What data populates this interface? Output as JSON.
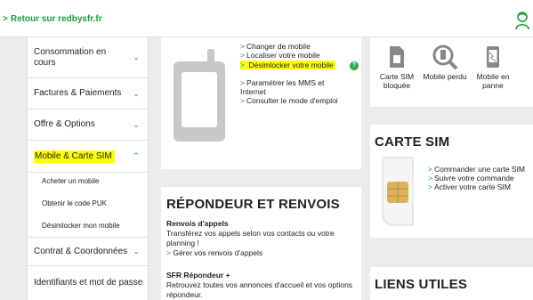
{
  "header": {
    "back_label": "Retour sur redbysfr.fr",
    "account_icon": "user-icon",
    "accent_color": "#1b9e3e"
  },
  "sidebar": {
    "items": [
      {
        "label": "Consommation en cours"
      },
      {
        "label": "Factures & Paiements"
      },
      {
        "label": "Offre & Options"
      },
      {
        "label": "Mobile & Carte SIM"
      },
      {
        "label": "Contrat & Coordonnées"
      },
      {
        "label": "Identifiants et mot de passe"
      }
    ],
    "sub_items": [
      {
        "label": "Acheter un mobile"
      },
      {
        "label": "Obtenir le code PUK"
      },
      {
        "label": "Désimlocker mon mobile"
      }
    ]
  },
  "mobile_card": {
    "links": [
      {
        "label": "Changer de mobile"
      },
      {
        "label": "Localiser votre mobile"
      },
      {
        "label": "Désimlocker votre mobile"
      },
      {
        "label": "Paramétrer les MMS et Internet"
      },
      {
        "label": "Consulter le mode d'emploi"
      }
    ],
    "help_label": "?"
  },
  "shortcuts": [
    {
      "label": "Carte SIM bloquée",
      "icon": "sim-card-icon"
    },
    {
      "label": "Mobile perdu",
      "icon": "magnifier-icon"
    },
    {
      "label": "Mobile en panne",
      "icon": "broken-phone-icon"
    }
  ],
  "sim_card": {
    "title": "CARTE SIM",
    "links": [
      {
        "label": "Commander une carte SIM"
      },
      {
        "label": "Suivre votre commande"
      },
      {
        "label": "Activer votre carte SIM"
      }
    ]
  },
  "repondeur": {
    "title": "RÉPONDEUR ET RENVOIS",
    "section1_title": "Renvois d'appels",
    "section1_text": "Transférez vos appels selon vos contacts ou votre planning !",
    "section1_link": "Gérer vos renvois d'appels",
    "section2_title": "SFR Répondeur +",
    "section2_text": "Retrouvez toutes vos annonces d'accueil et vos options répondeur."
  },
  "liens": {
    "title": "LIENS UTILES"
  }
}
